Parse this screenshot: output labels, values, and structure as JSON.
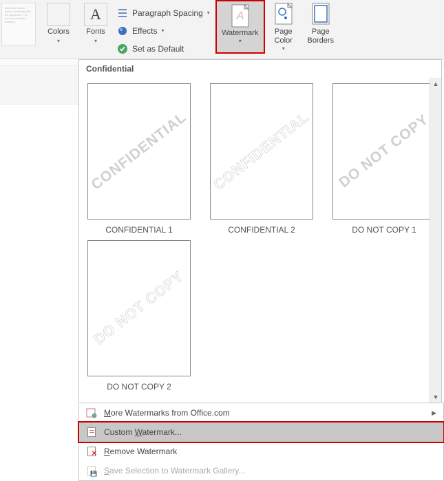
{
  "ribbon": {
    "themes_preview": "Galleries include items coordinate with the document. You can use of tables, headers,",
    "colors_label": "Colors",
    "fonts_label": "Fonts",
    "paragraph_spacing_label": "Paragraph Spacing",
    "effects_label": "Effects",
    "set_as_default_label": "Set as Default",
    "watermark_label": "Watermark",
    "page_color_label": "Page Color",
    "page_borders_label": "Page Borders",
    "colors": {
      "tl": "#404a5a",
      "tr": "#2f528f",
      "bl": "#ffffff",
      "br": "#ed7d31"
    }
  },
  "dropdown": {
    "section_label": "Confidential",
    "items": [
      {
        "wm": "CONFIDENTIAL",
        "style": "solid",
        "label": "CONFIDENTIAL 1"
      },
      {
        "wm": "CONFIDENTIAL",
        "style": "outline",
        "label": "CONFIDENTIAL 2"
      },
      {
        "wm": "DO NOT COPY",
        "style": "solid",
        "label": "DO NOT COPY 1"
      },
      {
        "wm": "DO NOT COPY",
        "style": "outline",
        "label": "DO NOT COPY 2"
      }
    ],
    "more_label": "More Watermarks from Office.com",
    "custom_label": "Custom Watermark...",
    "remove_label": "Remove Watermark",
    "save_label": "Save Selection to Watermark Gallery...",
    "mnemonic": {
      "more": "M",
      "custom": "W",
      "remove": "R",
      "save": "S"
    }
  }
}
